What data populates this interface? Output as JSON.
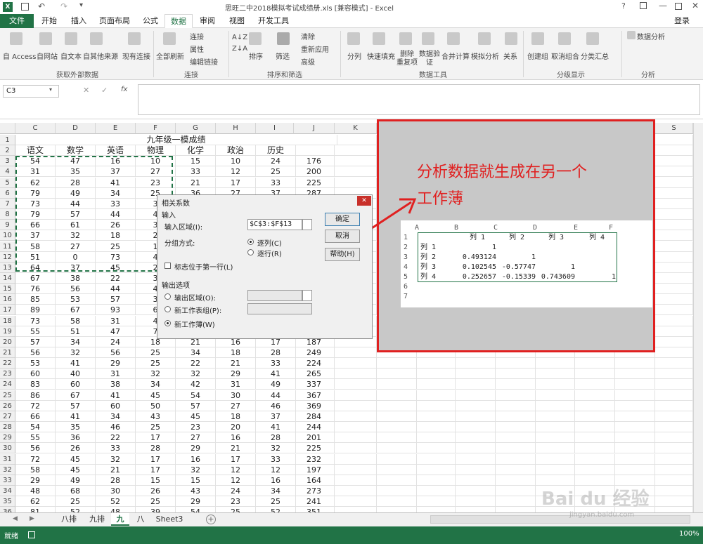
{
  "app": {
    "title": "思旺二中2018模拟考试成绩册.xls  [兼容模式] - Excel",
    "login": "登录",
    "file_tab": "文件"
  },
  "tabs": [
    "开始",
    "插入",
    "页面布局",
    "公式",
    "数据",
    "审阅",
    "视图",
    "开发工具"
  ],
  "ribbon": {
    "external": {
      "items": [
        "自 Access",
        "自网站",
        "自文本",
        "自其他来源",
        "现有连接"
      ],
      "group": "获取外部数据"
    },
    "conn": {
      "refresh": "全部刷新",
      "items": [
        "连接",
        "属性",
        "编辑链接"
      ],
      "group": "连接"
    },
    "sort": {
      "az": "A↓Z",
      "za": "Z↓A",
      "sort": "排序",
      "filter": "筛选",
      "items": [
        "清除",
        "重新应用",
        "高级"
      ],
      "group": "排序和筛选"
    },
    "tools": {
      "items": [
        "分列",
        "快速填充",
        "删除\n重复项",
        "数据验\n证",
        "合并计算",
        "模拟分析",
        "关系"
      ],
      "group": "数据工具"
    },
    "outline": {
      "items": [
        "创建组",
        "取消组合",
        "分类汇总"
      ],
      "group": "分级显示"
    },
    "analysis": {
      "label": "数据分析",
      "group": "分析"
    }
  },
  "formula_bar": {
    "name_box": "C3",
    "fx": "fx",
    "cancel": "✕",
    "enter": "✓"
  },
  "columns": [
    "C",
    "D",
    "E",
    "F",
    "G",
    "H",
    "I",
    "J",
    "K",
    "L",
    "M",
    "N",
    "O",
    "P",
    "Q",
    "R",
    "S"
  ],
  "sheet": {
    "title": "九年级一模成绩",
    "headers": [
      "语文",
      "数学",
      "英语",
      "物理",
      "化学",
      "政治",
      "历史"
    ],
    "rows": [
      [
        "54",
        "47",
        "16",
        "10",
        "15",
        "10",
        "24",
        "176"
      ],
      [
        "31",
        "35",
        "37",
        "27",
        "33",
        "12",
        "25",
        "200"
      ],
      [
        "62",
        "28",
        "41",
        "23",
        "21",
        "17",
        "33",
        "225"
      ],
      [
        "79",
        "49",
        "34",
        "25",
        "36",
        "27",
        "37",
        "287"
      ],
      [
        "73",
        "44",
        "33",
        "3",
        "",
        "",
        "",
        ""
      ],
      [
        "79",
        "57",
        "44",
        "4",
        "",
        "",
        "",
        ""
      ],
      [
        "66",
        "61",
        "26",
        "3",
        "",
        "",
        "",
        ""
      ],
      [
        "37",
        "32",
        "18",
        "2",
        "",
        "",
        "",
        ""
      ],
      [
        "58",
        "27",
        "25",
        "1",
        "",
        "",
        "",
        ""
      ],
      [
        "51",
        "0",
        "73",
        "4",
        "",
        "",
        "",
        ""
      ],
      [
        "64",
        "37",
        "45",
        "2",
        "",
        "",
        "",
        ""
      ],
      [
        "67",
        "38",
        "22",
        "3",
        "",
        "",
        "",
        ""
      ],
      [
        "76",
        "56",
        "44",
        "4",
        "",
        "",
        "",
        ""
      ],
      [
        "85",
        "53",
        "57",
        "3",
        "",
        "",
        "",
        ""
      ],
      [
        "89",
        "67",
        "93",
        "6",
        "",
        "",
        "",
        ""
      ],
      [
        "73",
        "58",
        "31",
        "4",
        "",
        "",
        "",
        ""
      ],
      [
        "55",
        "51",
        "47",
        "7",
        "",
        "",
        "",
        ""
      ],
      [
        "57",
        "34",
        "24",
        "18",
        "21",
        "16",
        "17",
        "187"
      ],
      [
        "56",
        "32",
        "56",
        "25",
        "34",
        "18",
        "28",
        "249"
      ],
      [
        "53",
        "41",
        "29",
        "25",
        "22",
        "21",
        "33",
        "224"
      ],
      [
        "60",
        "40",
        "31",
        "32",
        "32",
        "29",
        "41",
        "265"
      ],
      [
        "83",
        "60",
        "38",
        "34",
        "42",
        "31",
        "49",
        "337"
      ],
      [
        "86",
        "67",
        "41",
        "45",
        "54",
        "30",
        "44",
        "367"
      ],
      [
        "72",
        "57",
        "60",
        "50",
        "57",
        "27",
        "46",
        "369"
      ],
      [
        "66",
        "41",
        "34",
        "43",
        "45",
        "18",
        "37",
        "284"
      ],
      [
        "54",
        "35",
        "46",
        "25",
        "23",
        "20",
        "41",
        "244"
      ],
      [
        "55",
        "36",
        "22",
        "17",
        "27",
        "16",
        "28",
        "201"
      ],
      [
        "56",
        "26",
        "33",
        "28",
        "29",
        "21",
        "32",
        "225"
      ],
      [
        "72",
        "45",
        "32",
        "17",
        "16",
        "17",
        "33",
        "232"
      ],
      [
        "58",
        "45",
        "21",
        "17",
        "32",
        "12",
        "12",
        "197"
      ],
      [
        "29",
        "49",
        "28",
        "15",
        "15",
        "12",
        "16",
        "164"
      ],
      [
        "48",
        "68",
        "30",
        "26",
        "43",
        "24",
        "34",
        "273"
      ],
      [
        "62",
        "25",
        "52",
        "25",
        "29",
        "23",
        "25",
        "241"
      ],
      [
        "81",
        "52",
        "48",
        "39",
        "54",
        "25",
        "52",
        "351"
      ]
    ]
  },
  "dialog": {
    "title": "相关系数",
    "close": "✕",
    "input_section": "输入",
    "input_range_label": "输入区域(I):",
    "input_range": "$C$3:$F$13",
    "group_label": "分组方式:",
    "by_column": "逐列(C)",
    "by_row": "逐行(R)",
    "first_row_label": "标志位于第一行(L)",
    "output_section": "输出选项",
    "output_range": "输出区域(O):",
    "new_sheet": "新工作表组(P):",
    "new_workbook": "新工作薄(W)",
    "ok": "确定",
    "cancel": "取消",
    "help": "帮助(H)"
  },
  "annotation": {
    "text1": "分析数据就生成在另一个",
    "text2": "工作薄"
  },
  "result": {
    "cols": [
      "A",
      "B",
      "C",
      "D",
      "E",
      "F"
    ],
    "rows": [
      "1",
      "2",
      "3",
      "4",
      "5",
      "6",
      "7"
    ],
    "headers": [
      "列 1",
      "列 2",
      "列 3",
      "列 4"
    ],
    "data": [
      [
        "列 1",
        "1",
        "",
        "",
        ""
      ],
      [
        "列 2",
        "0.493124",
        "1",
        "",
        ""
      ],
      [
        "列 3",
        "0.102545",
        "-0.57747",
        "1",
        ""
      ],
      [
        "列 4",
        "0.252657",
        "-0.15339",
        "0.743609",
        "1"
      ]
    ]
  },
  "sheets": [
    "八排",
    "九排",
    "九",
    "八",
    "Sheet3"
  ],
  "active_sheet": "九",
  "status": {
    "ready": "就绪",
    "zoom": "100%"
  },
  "watermark": "Bai du 经验",
  "watermark_url": "jingyan.baidu.com"
}
